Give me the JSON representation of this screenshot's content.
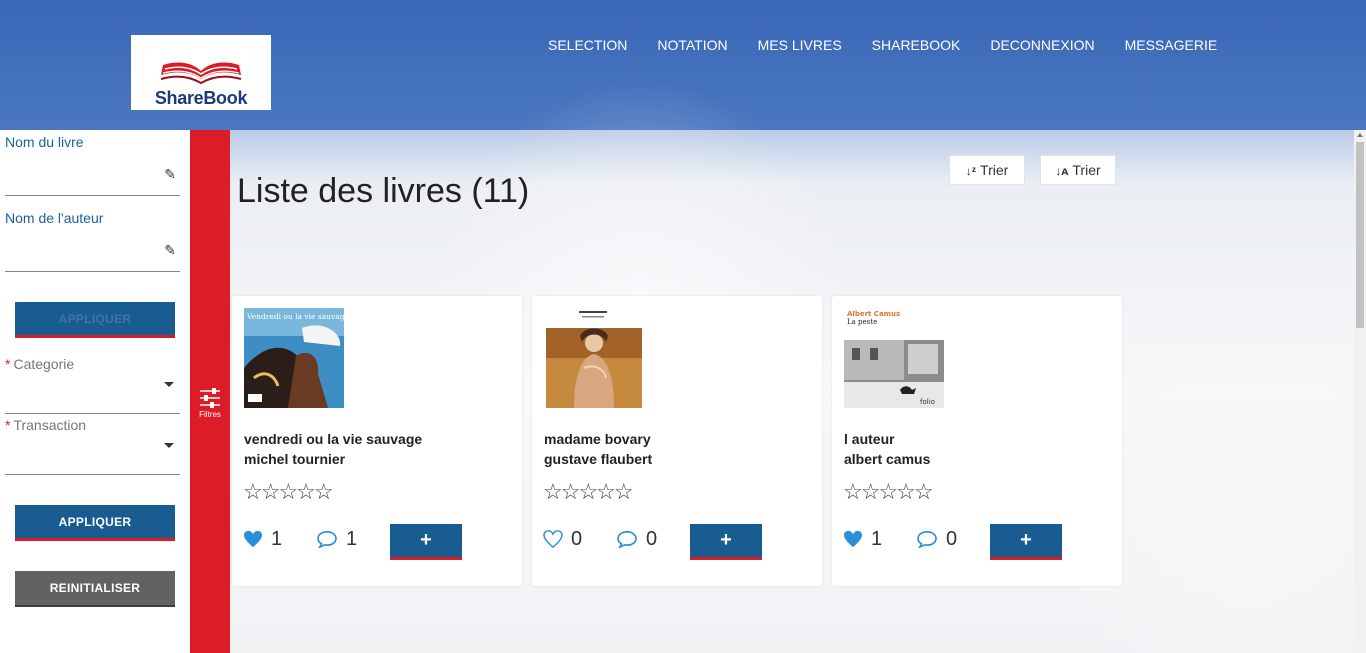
{
  "brand": {
    "name": "ShareBook"
  },
  "nav": [
    "SELECTION",
    "NOTATION",
    "MES LIVRES",
    "SHAREBOOK",
    "DECONNEXION",
    "MESSAGERIE"
  ],
  "filters": {
    "book_name_label": "Nom du livre",
    "author_label": "Nom de l'auteur",
    "apply_top": "APPLIQUER",
    "category_label": "Categorie",
    "transaction_label": "Transaction",
    "required_mark": "*",
    "apply": "APPLIQUER",
    "reset": "REINITIALISER",
    "tab_label": "Filtres"
  },
  "main": {
    "heading": "Liste des livres (11)",
    "sort_desc": "Trier",
    "sort_asc": "Trier"
  },
  "books": [
    {
      "title": "vendredi ou la vie sauvage",
      "author": "michel tournier",
      "rating": 0,
      "likes": "1",
      "liked": true,
      "comments": "1",
      "cover_text": "Vendredi ou la vie sauvage"
    },
    {
      "title": "madame bovary",
      "author": "gustave flaubert",
      "rating": 0,
      "likes": "0",
      "liked": false,
      "comments": "0",
      "cover_text": ""
    },
    {
      "title": "l auteur",
      "author": "albert camus",
      "rating": 0,
      "likes": "1",
      "liked": true,
      "comments": "0",
      "cover_text": "Albert Camus",
      "cover_subtitle": "La peste",
      "cover_publisher": "folio"
    }
  ],
  "add_button": "+",
  "colors": {
    "header_blue": "#3a67b7",
    "accent_red": "#dc1d27",
    "button_blue": "#195c92",
    "heart_blue": "#2a8fd6"
  }
}
